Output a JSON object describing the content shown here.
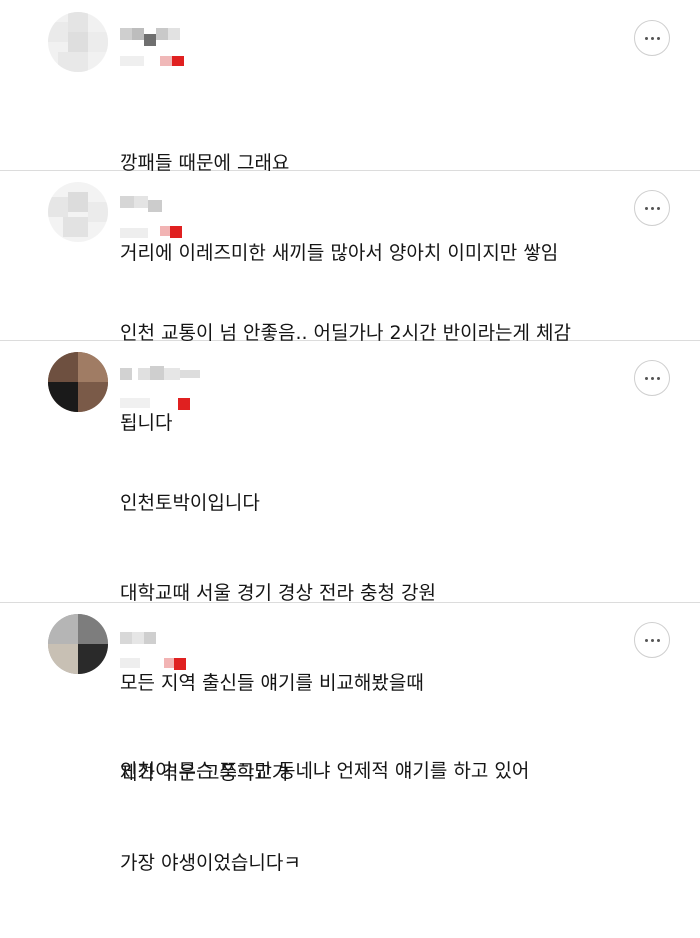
{
  "comments": [
    {
      "author": "",
      "lines": [
        "깡패들 때문에 그래요",
        "거리에 이레즈미한 새끼들 많아서 양아치 이미지만 쌓임"
      ],
      "more_icon": "more-horizontal-icon",
      "badge_color": "#e02020"
    },
    {
      "author": "",
      "lines": [
        "인천 교통이 넘 안좋음.. 어딜가나 2시간 반이라는게 체감",
        "됩니다"
      ],
      "more_icon": "more-horizontal-icon",
      "badge_color": "#e02020"
    },
    {
      "author": "",
      "lines": [
        "인천토박이입니다",
        "대학교때 서울 경기 경상 전라 충청 강원",
        "모든 지역 출신들 얘기를 비교해봤을때",
        "제가 겪은 고등학교가",
        "가장 야생이었습니다ㅋ"
      ],
      "more_icon": "more-horizontal-icon",
      "badge_color": "#e02020"
    },
    {
      "author": "",
      "lines": [
        "인천이 무슨 쪼그만 동네냐 언제적 얘기를 하고 있어"
      ],
      "more_icon": "more-horizontal-icon",
      "badge_color": "#e02020"
    }
  ]
}
